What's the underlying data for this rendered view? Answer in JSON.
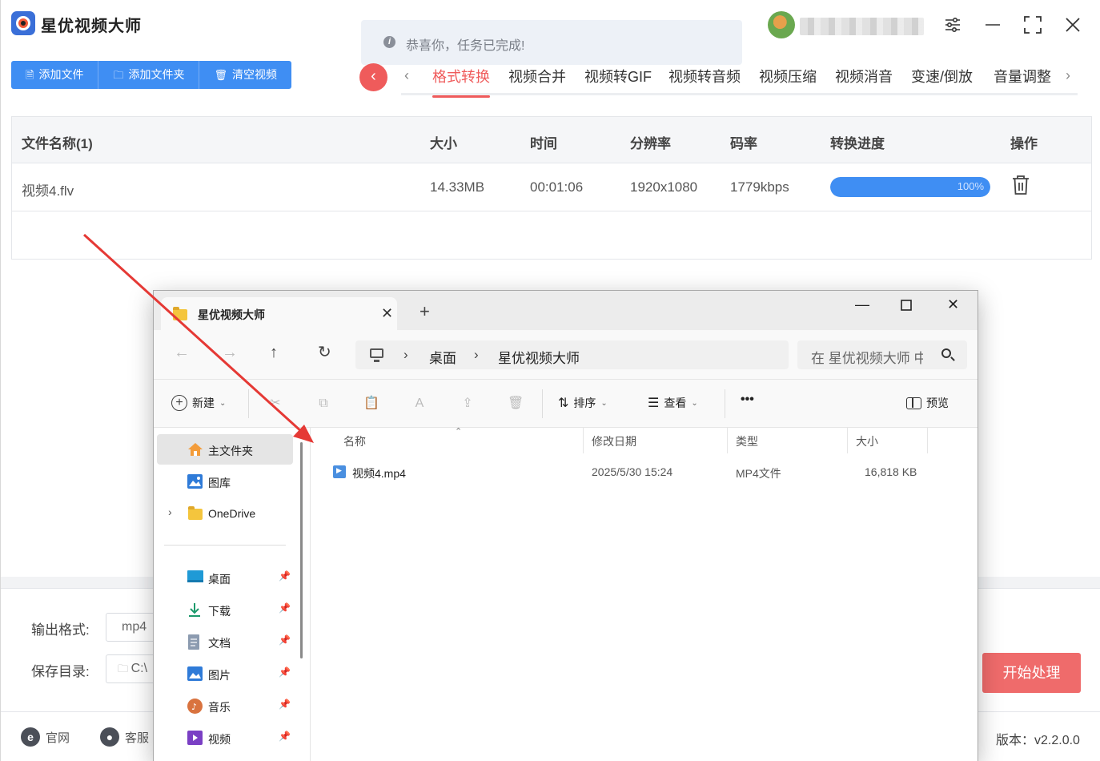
{
  "app": {
    "title": "星优视频大师",
    "toast_icon": "info-icon",
    "toast": "恭喜你，任务已完成!",
    "user_name_masked": ""
  },
  "actions": {
    "add_file": "添加文件",
    "add_folder": "添加文件夹",
    "clear_videos": "清空视频"
  },
  "tabs": [
    "格式转换",
    "视频合并",
    "视频转GIF",
    "视频转音频",
    "视频压缩",
    "视频消音",
    "变速/倒放",
    "音量调整"
  ],
  "active_tab": "格式转换",
  "table": {
    "headers": [
      "文件名称(1)",
      "大小",
      "时间",
      "分辨率",
      "码率",
      "转换进度",
      "操作"
    ],
    "rows": [
      {
        "name": "视频4.flv",
        "size": "14.33MB",
        "duration": "00:01:06",
        "resolution": "1920x1080",
        "bitrate": "1779kbps",
        "progress": 100,
        "progress_label": "100%"
      }
    ]
  },
  "output": {
    "format_label": "输出格式:",
    "format_value": "mp4",
    "dir_label": "保存目录:",
    "dir_value": "C:\\"
  },
  "start_button": "开始处理",
  "footer": {
    "website": "官网",
    "support": "客服",
    "version": "版本：v2.2.0.0"
  },
  "explorer": {
    "tab_title": "星优视频大师",
    "breadcrumb": [
      "桌面",
      "星优视频大师"
    ],
    "search_placeholder": "在 星优视频大师 中搜索",
    "commands": {
      "new": "新建",
      "sort": "排序",
      "view": "查看",
      "more": "•••",
      "preview": "预览"
    },
    "sidebar": [
      {
        "label": "主文件夹",
        "icon": "home-icon",
        "pinned": false,
        "selected": true
      },
      {
        "label": "图库",
        "icon": "gallery-icon",
        "pinned": false
      },
      {
        "label": "OneDrive",
        "icon": "folder-icon",
        "pinned": false,
        "expandable": true
      },
      {
        "label": "桌面",
        "icon": "desktop-icon",
        "pinned": true
      },
      {
        "label": "下载",
        "icon": "download-icon",
        "pinned": true
      },
      {
        "label": "文档",
        "icon": "document-icon",
        "pinned": true
      },
      {
        "label": "图片",
        "icon": "pictures-icon",
        "pinned": true
      },
      {
        "label": "音乐",
        "icon": "music-icon",
        "pinned": true
      },
      {
        "label": "视频",
        "icon": "video-icon",
        "pinned": true
      }
    ],
    "columns": [
      "名称",
      "修改日期",
      "类型",
      "大小"
    ],
    "files": [
      {
        "name": "视频4.mp4",
        "modified": "2025/5/30 15:24",
        "type": "MP4文件",
        "size": "16,818 KB"
      }
    ]
  },
  "colors": {
    "primary_blue": "#3f8ef3",
    "accent_red": "#ef5b5b",
    "annotation_arrow": "#e53935"
  }
}
